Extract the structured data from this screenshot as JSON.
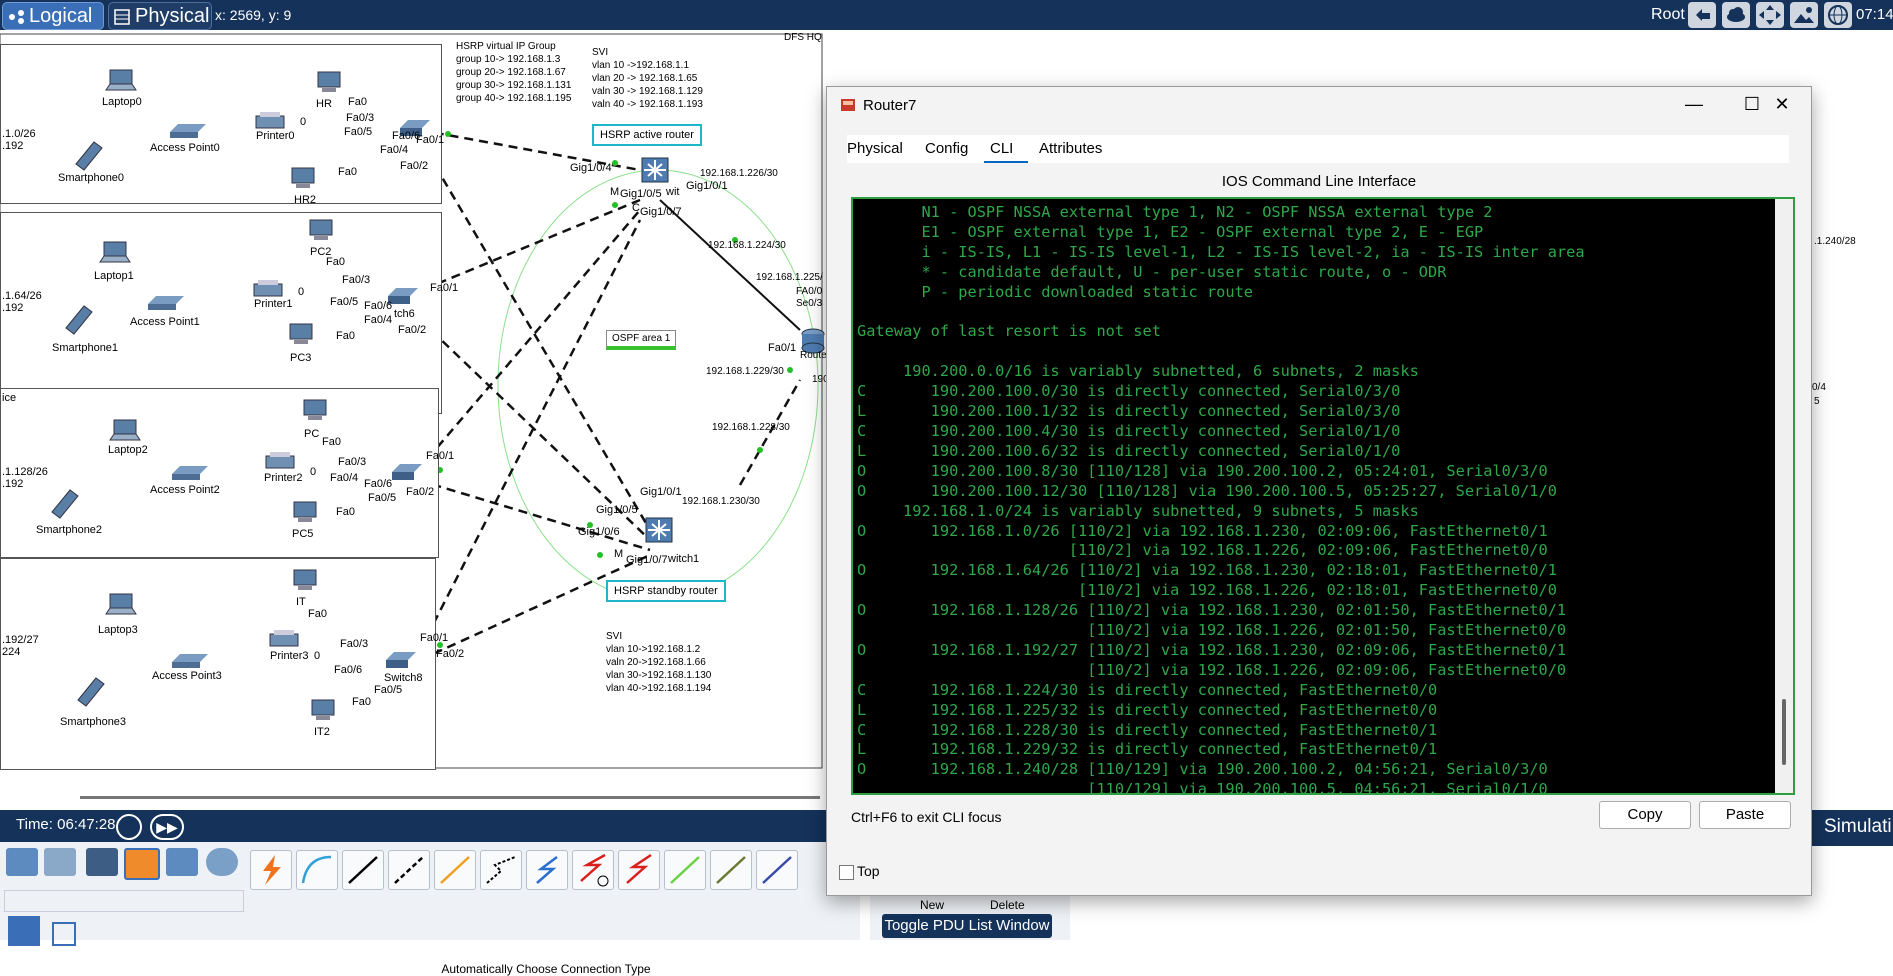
{
  "topbar": {
    "logical_label": "Logical",
    "physical_label": "Physical",
    "coords": "x: 2569, y: 9",
    "user": "Root",
    "clock": "07:14",
    "icons": [
      "back-arrow-icon",
      "cloud-icon",
      "move-icon",
      "image-icon",
      "network-globe-icon"
    ]
  },
  "topology": {
    "rooms": {
      "hr": {
        "network": ".1.0/26",
        "mask": ".192",
        "devices": {
          "laptop": "Laptop0",
          "ap": "Access Point0",
          "phone": "Smartphone0",
          "printer": "Printer0",
          "pc_a": "HR",
          "pc_b": "HR2"
        }
      },
      "room2": {
        "network": ".1.64/26",
        "mask": ".192",
        "devices": {
          "laptop": "Laptop1",
          "ap": "Access Point1",
          "phone": "Smartphone1",
          "printer": "Printer1",
          "pc_a": "PC2",
          "pc_b": "PC3",
          "switch": "tch6"
        }
      },
      "room3": {
        "title": "ice",
        "network": ".1.128/26",
        "mask": ".192",
        "devices": {
          "laptop": "Laptop2",
          "ap": "Access Point2",
          "phone": "Smartphone2",
          "printer": "Printer2",
          "pc_a": "PC",
          "pc_b": "PC5"
        }
      },
      "room4": {
        "network": ".192/27",
        "mask": "224",
        "devices": {
          "laptop": "Laptop3",
          "ap": "Access Point3",
          "phone": "Smartphone3",
          "printer": "Printer3",
          "pc_a": "IT",
          "pc_b": "IT2",
          "switch": "Switch8"
        }
      }
    },
    "ports": {
      "fa0": "Fa0",
      "fa0_3": "Fa0/3",
      "fa0_4": "Fa0/4",
      "fa0_5": "Fa0/5",
      "fa0_6": "Fa0/6",
      "fa0_1": "Fa0/1",
      "fa0_2": "Fa0/2",
      "zero": "0",
      "g104": "Gig1/0/4",
      "g105": "Gig1/0/5",
      "g101": "Gig1/0/1",
      "g107": "Gig1/0/7",
      "g106": "Gig1/0/6",
      "m": "M",
      "c": "C",
      "wit": "wit",
      "witch1": "witch1",
      "se": "Se0/3",
      "route": "Route",
      "r190": "190",
      "rfa00": "FA0/0",
      "fa01r": "Fa0/1"
    },
    "hq_label": "DFS HQ",
    "hsrp_group": {
      "title": "HSRP  virtual IP Group",
      "lines": [
        "group 10-> 192.168.1.3",
        "group 20-> 192.168.1.67",
        "group 30-> 192.168.1.131",
        "group 40-> 192.168.1.195"
      ]
    },
    "svi_active": {
      "title": "SVI",
      "lines": [
        "vlan 10 ->192.168.1.1",
        "vlan 20 -> 192.168.1.65",
        "valn 30 -> 192.168.1.129",
        "valn 40 -> 192.168.1.193"
      ]
    },
    "svi_standby": {
      "title": "SVI",
      "lines": [
        "vlan 10->192.168.1.2",
        "valn 20->192.168.1.66",
        "vlan 30->192.168.1.130",
        "vlan 40->192.168.1.194"
      ]
    },
    "hsrp_active": "HSRP active router",
    "hsrp_standby": "HSRP standby router",
    "ospf_area": "OSPF area 1",
    "links": {
      "l226": "192.168.1.226/30",
      "l224": "192.168.1.224/30",
      "l225": "192.168.1.225/",
      "l229": "192.168.1.229/30",
      "l228": "192.168.1.228/30",
      "l230": "192.168.1.230/30"
    },
    "right_side": {
      "net": ".1.240/28",
      "port_a": "0/4",
      "port_b": "5"
    }
  },
  "router_window": {
    "title": "Router7",
    "tabs": [
      "Physical",
      "Config",
      "CLI",
      "Attributes"
    ],
    "active_tab": "CLI",
    "cli_heading": "IOS Command Line Interface",
    "cli_output": "       N1 - OSPF NSSA external type 1, N2 - OSPF NSSA external type 2\n       E1 - OSPF external type 1, E2 - OSPF external type 2, E - EGP\n       i - IS-IS, L1 - IS-IS level-1, L2 - IS-IS level-2, ia - IS-IS inter area\n       * - candidate default, U - per-user static route, o - ODR\n       P - periodic downloaded static route\n\nGateway of last resort is not set\n\n     190.200.0.0/16 is variably subnetted, 6 subnets, 2 masks\nC       190.200.100.0/30 is directly connected, Serial0/3/0\nL       190.200.100.1/32 is directly connected, Serial0/3/0\nC       190.200.100.4/30 is directly connected, Serial0/1/0\nL       190.200.100.6/32 is directly connected, Serial0/1/0\nO       190.200.100.8/30 [110/128] via 190.200.100.2, 05:24:01, Serial0/3/0\nO       190.200.100.12/30 [110/128] via 190.200.100.5, 05:25:27, Serial0/1/0\n     192.168.1.0/24 is variably subnetted, 9 subnets, 5 masks\nO       192.168.1.0/26 [110/2] via 192.168.1.230, 02:09:06, FastEthernet0/1\n                       [110/2] via 192.168.1.226, 02:09:06, FastEthernet0/0\nO       192.168.1.64/26 [110/2] via 192.168.1.230, 02:18:01, FastEthernet0/1\n                        [110/2] via 192.168.1.226, 02:18:01, FastEthernet0/0\nO       192.168.1.128/26 [110/2] via 192.168.1.230, 02:01:50, FastEthernet0/1\n                         [110/2] via 192.168.1.226, 02:01:50, FastEthernet0/0\nO       192.168.1.192/27 [110/2] via 192.168.1.230, 02:09:06, FastEthernet0/1\n                         [110/2] via 192.168.1.226, 02:09:06, FastEthernet0/0\nC       192.168.1.224/30 is directly connected, FastEthernet0/0\nL       192.168.1.225/32 is directly connected, FastEthernet0/0\nC       192.168.1.228/30 is directly connected, FastEthernet0/1\nL       192.168.1.229/32 is directly connected, FastEthernet0/1\nO       192.168.1.240/28 [110/129] via 190.200.100.2, 04:56:21, Serial0/3/0\n                         [110/129] via 190.200.100.5, 04:56:21, Serial0/1/0",
    "ctrl_hint": "Ctrl+F6 to exit CLI focus",
    "copy_label": "Copy",
    "paste_label": "Paste",
    "top_label": "Top",
    "top_checked": false
  },
  "bottom": {
    "time": "Time: 06:47:28",
    "auto_conn": "Automatically Choose Connection Type",
    "toggle_pdu": "Toggle PDU List Window",
    "simulation": "Simulati",
    "new_label": "New",
    "delete_label": "Delete"
  },
  "colors": {
    "topbar": "#14325a",
    "cli_text": "#2ea84a",
    "cli_border": "#2ea043",
    "hsrp_badge": "#1fb6c9",
    "ospf_bar": "#36c22e"
  }
}
